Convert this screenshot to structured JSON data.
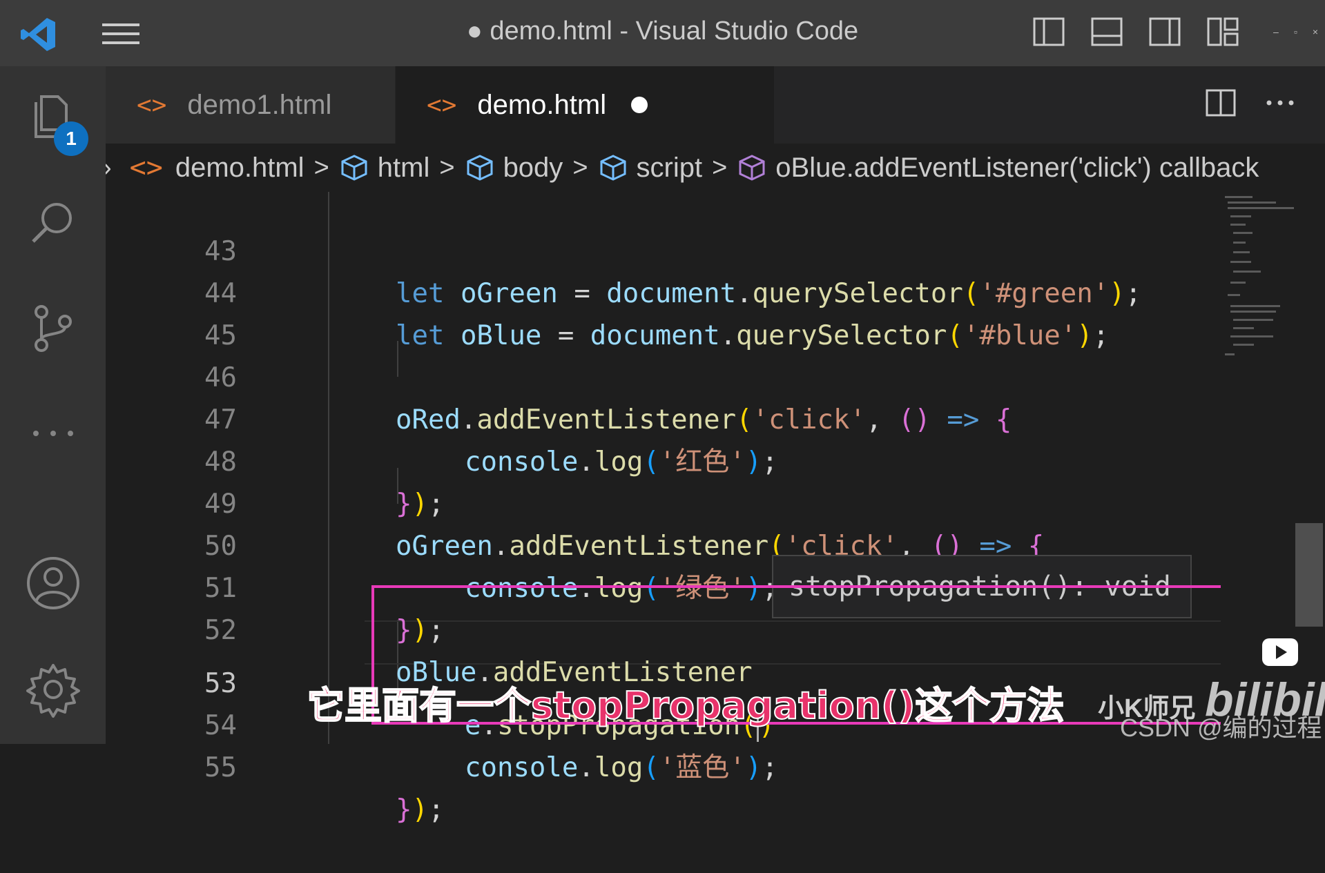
{
  "window": {
    "title": "● demo.html - Visual Studio Code",
    "controls": [
      "–",
      "▫",
      "×"
    ]
  },
  "activitybar": {
    "explorer_badge": "1"
  },
  "tabs": [
    {
      "label": "demo1.html",
      "icon": "<>"
    },
    {
      "label": "demo.html",
      "icon": "<>"
    }
  ],
  "breadcrumb": {
    "items": [
      "demo.html",
      "html",
      "body",
      "script",
      "oBlue.addEventListener('click') callback"
    ],
    "lead": "›"
  },
  "editor": {
    "lines": [
      {
        "n": "43"
      },
      {
        "n": "44"
      },
      {
        "n": "45"
      },
      {
        "n": "46"
      },
      {
        "n": "47"
      },
      {
        "n": "48"
      },
      {
        "n": "49"
      },
      {
        "n": "50"
      },
      {
        "n": "51"
      },
      {
        "n": "52"
      },
      {
        "n": "53"
      },
      {
        "n": "54"
      },
      {
        "n": "55"
      }
    ],
    "tokens": {
      "let": "let",
      "oGreen": "oGreen",
      "oBlue": "oBlue",
      "oRed": "oRed",
      "document": "document",
      "querySelector": "querySelector",
      "green_sel": "'#green'",
      "blue_sel": "'#blue'",
      "addEventListener": "addEventListener",
      "click": "'click'",
      "console": "console",
      "log": "log",
      "red_cn": "'红色'",
      "green_cn": "'绿色'",
      "blue_cn": "'蓝色'",
      "e": "e",
      "stopPropagation": "stopPropagation"
    },
    "tooltip": "stopPropagation(): void"
  },
  "overlay": {
    "subtitle": "它里面有一个stopPropagation()这个方法",
    "uploader": "小K师兄",
    "platform_logo": "bilibili",
    "csdn": "CSDN @编的过程"
  },
  "colors": {
    "accent_highlight": "#e83ab9",
    "subtitle": "#e8336b",
    "badge": "#0e70c0"
  }
}
